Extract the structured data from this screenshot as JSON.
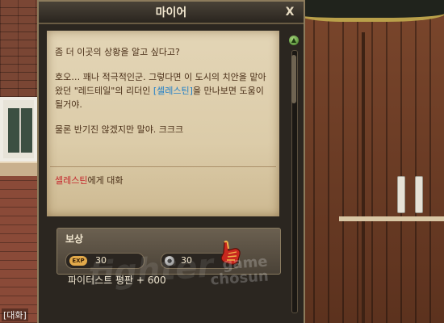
{
  "dialog": {
    "title": "마이어",
    "close_label": "X"
  },
  "dialogue": {
    "line1": "좀 더 이곳의 상황을 알고 싶다고?",
    "line2_part1": "호오… 꽤나 적극적인군. 그렇다면 이 도시의 치안을 맡아왔던 \"레드테일\"의 리더인 ",
    "line2_link": "[셀레스틴]",
    "line2_part2": "을 만나보면 도움이 될거야.",
    "line3": "물론 반기진 않겠지만 말야. 크크크"
  },
  "talk_option": {
    "npc_name": "셀레스틴",
    "suffix": "에게 대화"
  },
  "reward": {
    "title": "보상",
    "exp_badge": "EXP",
    "exp_value": "30",
    "gold_value": "30",
    "reputation": "파이터스트 평판 + 600"
  },
  "watermark": {
    "brand": "fighter",
    "line1": "game",
    "line2": "chosun"
  },
  "status": {
    "chat_tag": "[대화]"
  },
  "colors": {
    "link": "#1f7fc8",
    "npc": "#c4242a",
    "parchment": "#dccca9"
  },
  "icons": {
    "close": "close-icon",
    "scroll_up": "triangle-up-icon",
    "exp": "exp-icon",
    "gold": "coin-icon",
    "cursor": "hand-cursor-icon"
  }
}
